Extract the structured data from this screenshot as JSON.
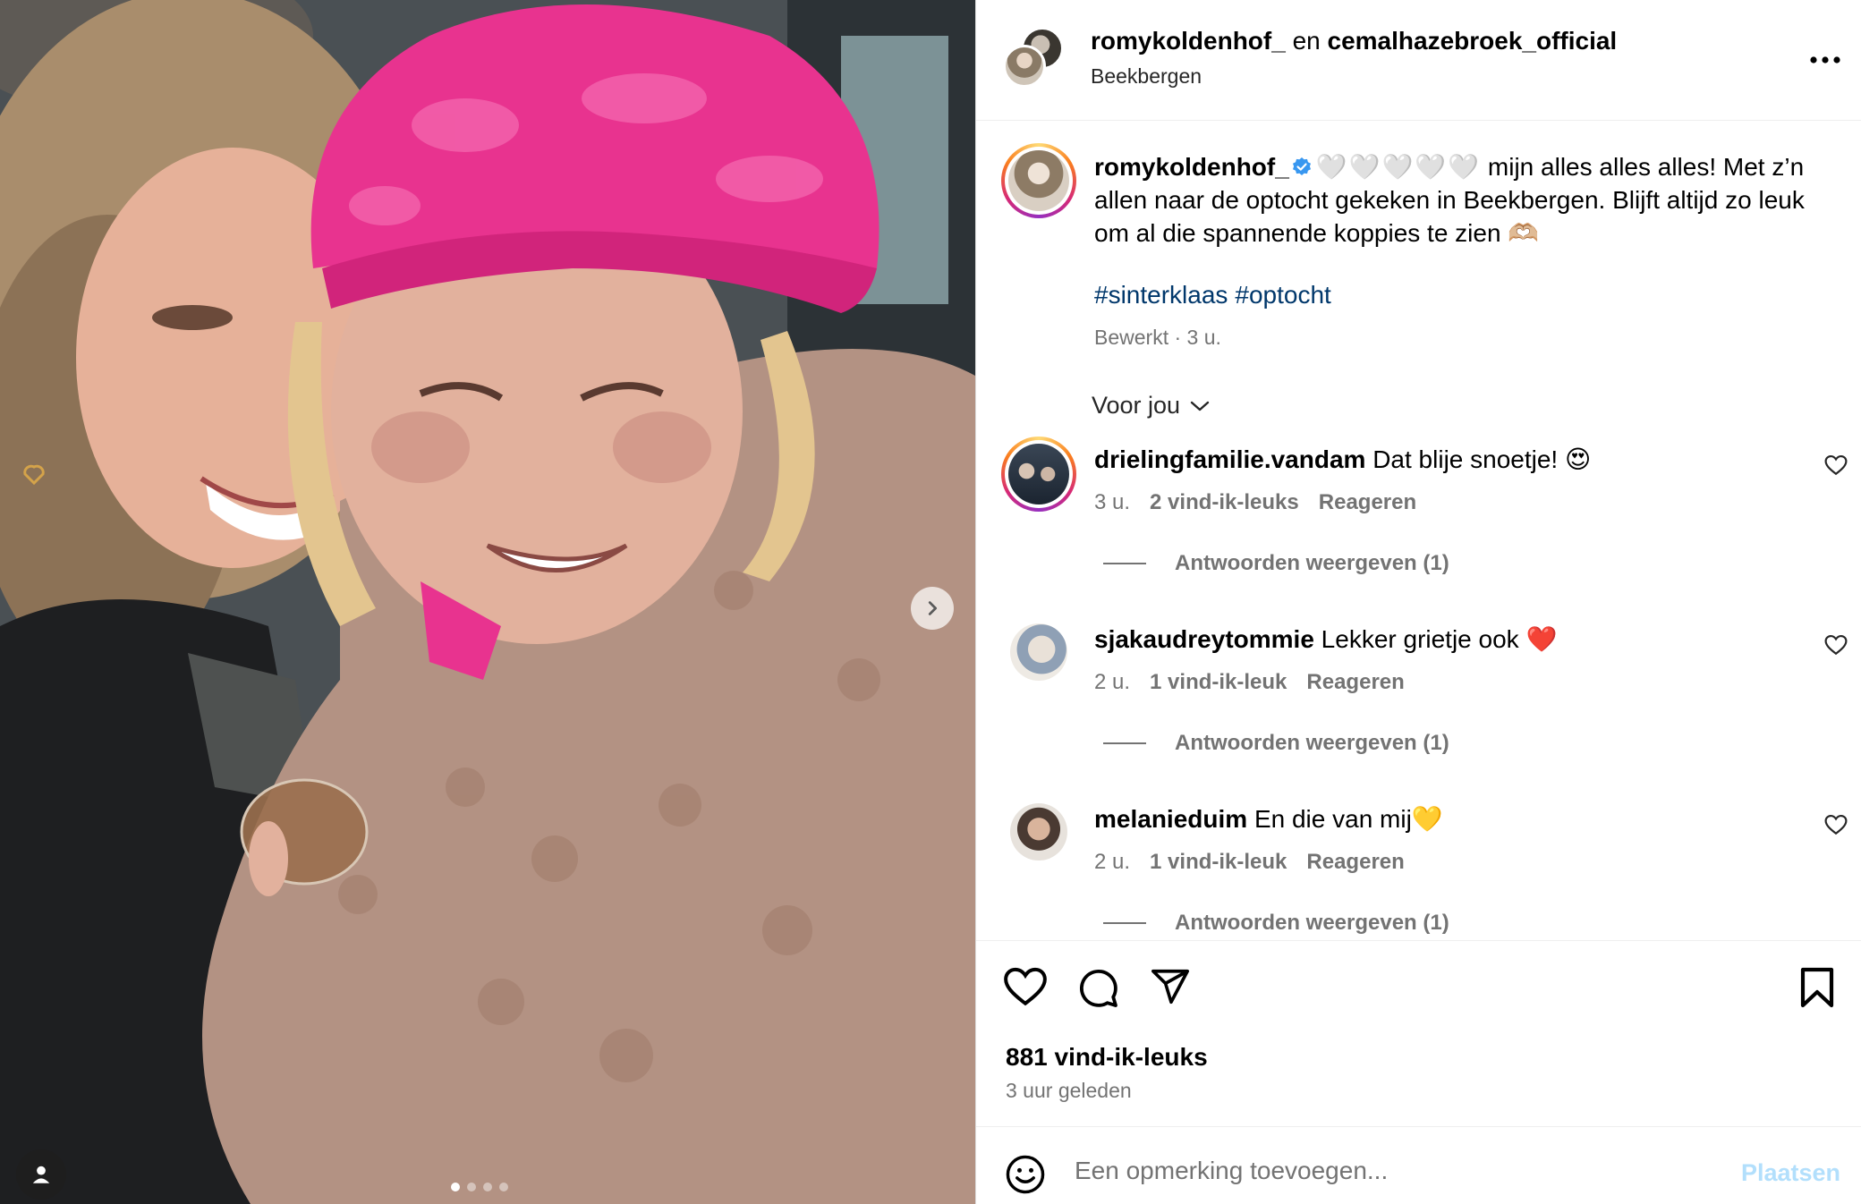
{
  "post": {
    "photo_alt_people": "",
    "carousel": {
      "total": 4,
      "active": 1
    }
  },
  "header": {
    "user1": "romykoldenhof_",
    "joiner": " en ",
    "user2": "cemalhazebroek_official",
    "location": "Beekbergen",
    "more_icon": "more-horizontal-icon"
  },
  "caption": {
    "username": "romykoldenhof_",
    "hearts": "🤍🤍🤍🤍🤍",
    "text": " mijn alles alles alles! Met z’n allen naar de optocht gekeken in Beekbergen. Blijft altijd zo leuk om al die spannende koppies te zien 🫶🏼",
    "hashtags": [
      "#sinterklaas",
      "#optocht"
    ],
    "edited": "Bewerkt",
    "time": "3 u."
  },
  "for_you": {
    "label": "Voor jou"
  },
  "comments": [
    {
      "username": "drielingfamilie.vandam",
      "text": "Dat blije snoetje! 😍",
      "time": "3 u.",
      "likes": "2 vind-ik-leuks",
      "reply": "Reageren",
      "replies": "Antwoorden weergeven (1)",
      "story_ring": true
    },
    {
      "username": "sjakaudreytommie",
      "text": "Lekker grietje ook ❤️",
      "time": "2 u.",
      "likes": "1 vind-ik-leuk",
      "reply": "Reageren",
      "replies": "Antwoorden weergeven (1)",
      "story_ring": false
    },
    {
      "username": "melanieduim",
      "text": "En die van mij💛",
      "time": "2 u.",
      "likes": "1 vind-ik-leuk",
      "reply": "Reageren",
      "replies": "Antwoorden weergeven (1)",
      "story_ring": false
    }
  ],
  "actions": {
    "likes": "881 vind-ik-leuks",
    "time_ago": "3 uur geleden",
    "icons": [
      "heart-icon",
      "comment-icon",
      "share-icon",
      "bookmark-icon"
    ]
  },
  "add_comment": {
    "placeholder": "Een opmerking toevoegen...",
    "post_label": "Plaatsen"
  },
  "colors": {
    "link": "#00376b",
    "muted": "#737373",
    "verified": "#3897f0",
    "post_disabled": "#b2dffc",
    "hat_pink": "#e8338f"
  }
}
